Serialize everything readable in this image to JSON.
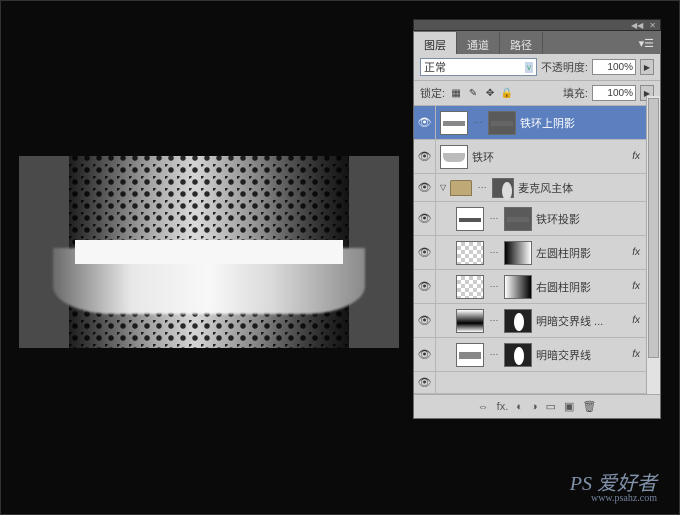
{
  "panel": {
    "tabs": [
      "图层",
      "通道",
      "路径"
    ],
    "blend_mode": "正常",
    "opacity_label": "不透明度:",
    "opacity_value": "100%",
    "lock_label": "锁定:",
    "fill_label": "填充:",
    "fill_value": "100%"
  },
  "layers": [
    {
      "name": "铁环上阴影",
      "selected": true,
      "fx": false,
      "masked": true
    },
    {
      "name": "铁环",
      "selected": false,
      "fx": true,
      "masked": false
    },
    {
      "name": "麦克风主体",
      "selected": false,
      "group": true
    },
    {
      "name": "铁环投影",
      "selected": false,
      "fx": false,
      "masked": true,
      "indent": 1
    },
    {
      "name": "左圆柱阴影",
      "selected": false,
      "fx": true,
      "masked": true,
      "indent": 1
    },
    {
      "name": "右圆柱阴影",
      "selected": false,
      "fx": true,
      "masked": true,
      "indent": 1
    },
    {
      "name": "明暗交界线 ...",
      "selected": false,
      "fx": true,
      "masked": true,
      "indent": 1
    },
    {
      "name": "明暗交界线",
      "selected": false,
      "fx": true,
      "masked": true,
      "indent": 1
    }
  ],
  "watermark": {
    "brand": "PS 爱好者",
    "url": "www.psahz.com"
  }
}
